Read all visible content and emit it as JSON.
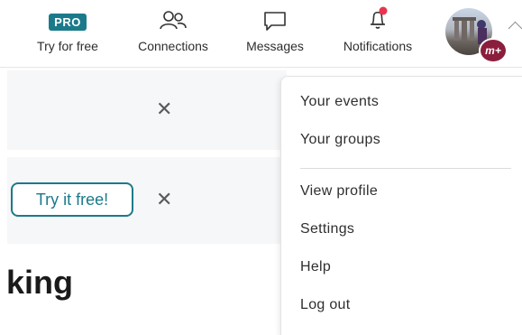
{
  "nav": {
    "pro_badge": "PRO",
    "try_free_label": "Try for free",
    "connections_label": "Connections",
    "messages_label": "Messages",
    "notifications_label": "Notifications",
    "avatar_badge": "m+",
    "accent_color": "#1b7a8a",
    "notification_dot_color": "#e8344e"
  },
  "banners": {
    "try_button_label": "Try it free!",
    "close_glyph": "✕"
  },
  "page": {
    "heading_fragment": "king"
  },
  "dropdown": {
    "items_top": [
      "Your events",
      "Your groups"
    ],
    "items_bottom": [
      "View profile",
      "Settings",
      "Help",
      "Log out"
    ]
  }
}
